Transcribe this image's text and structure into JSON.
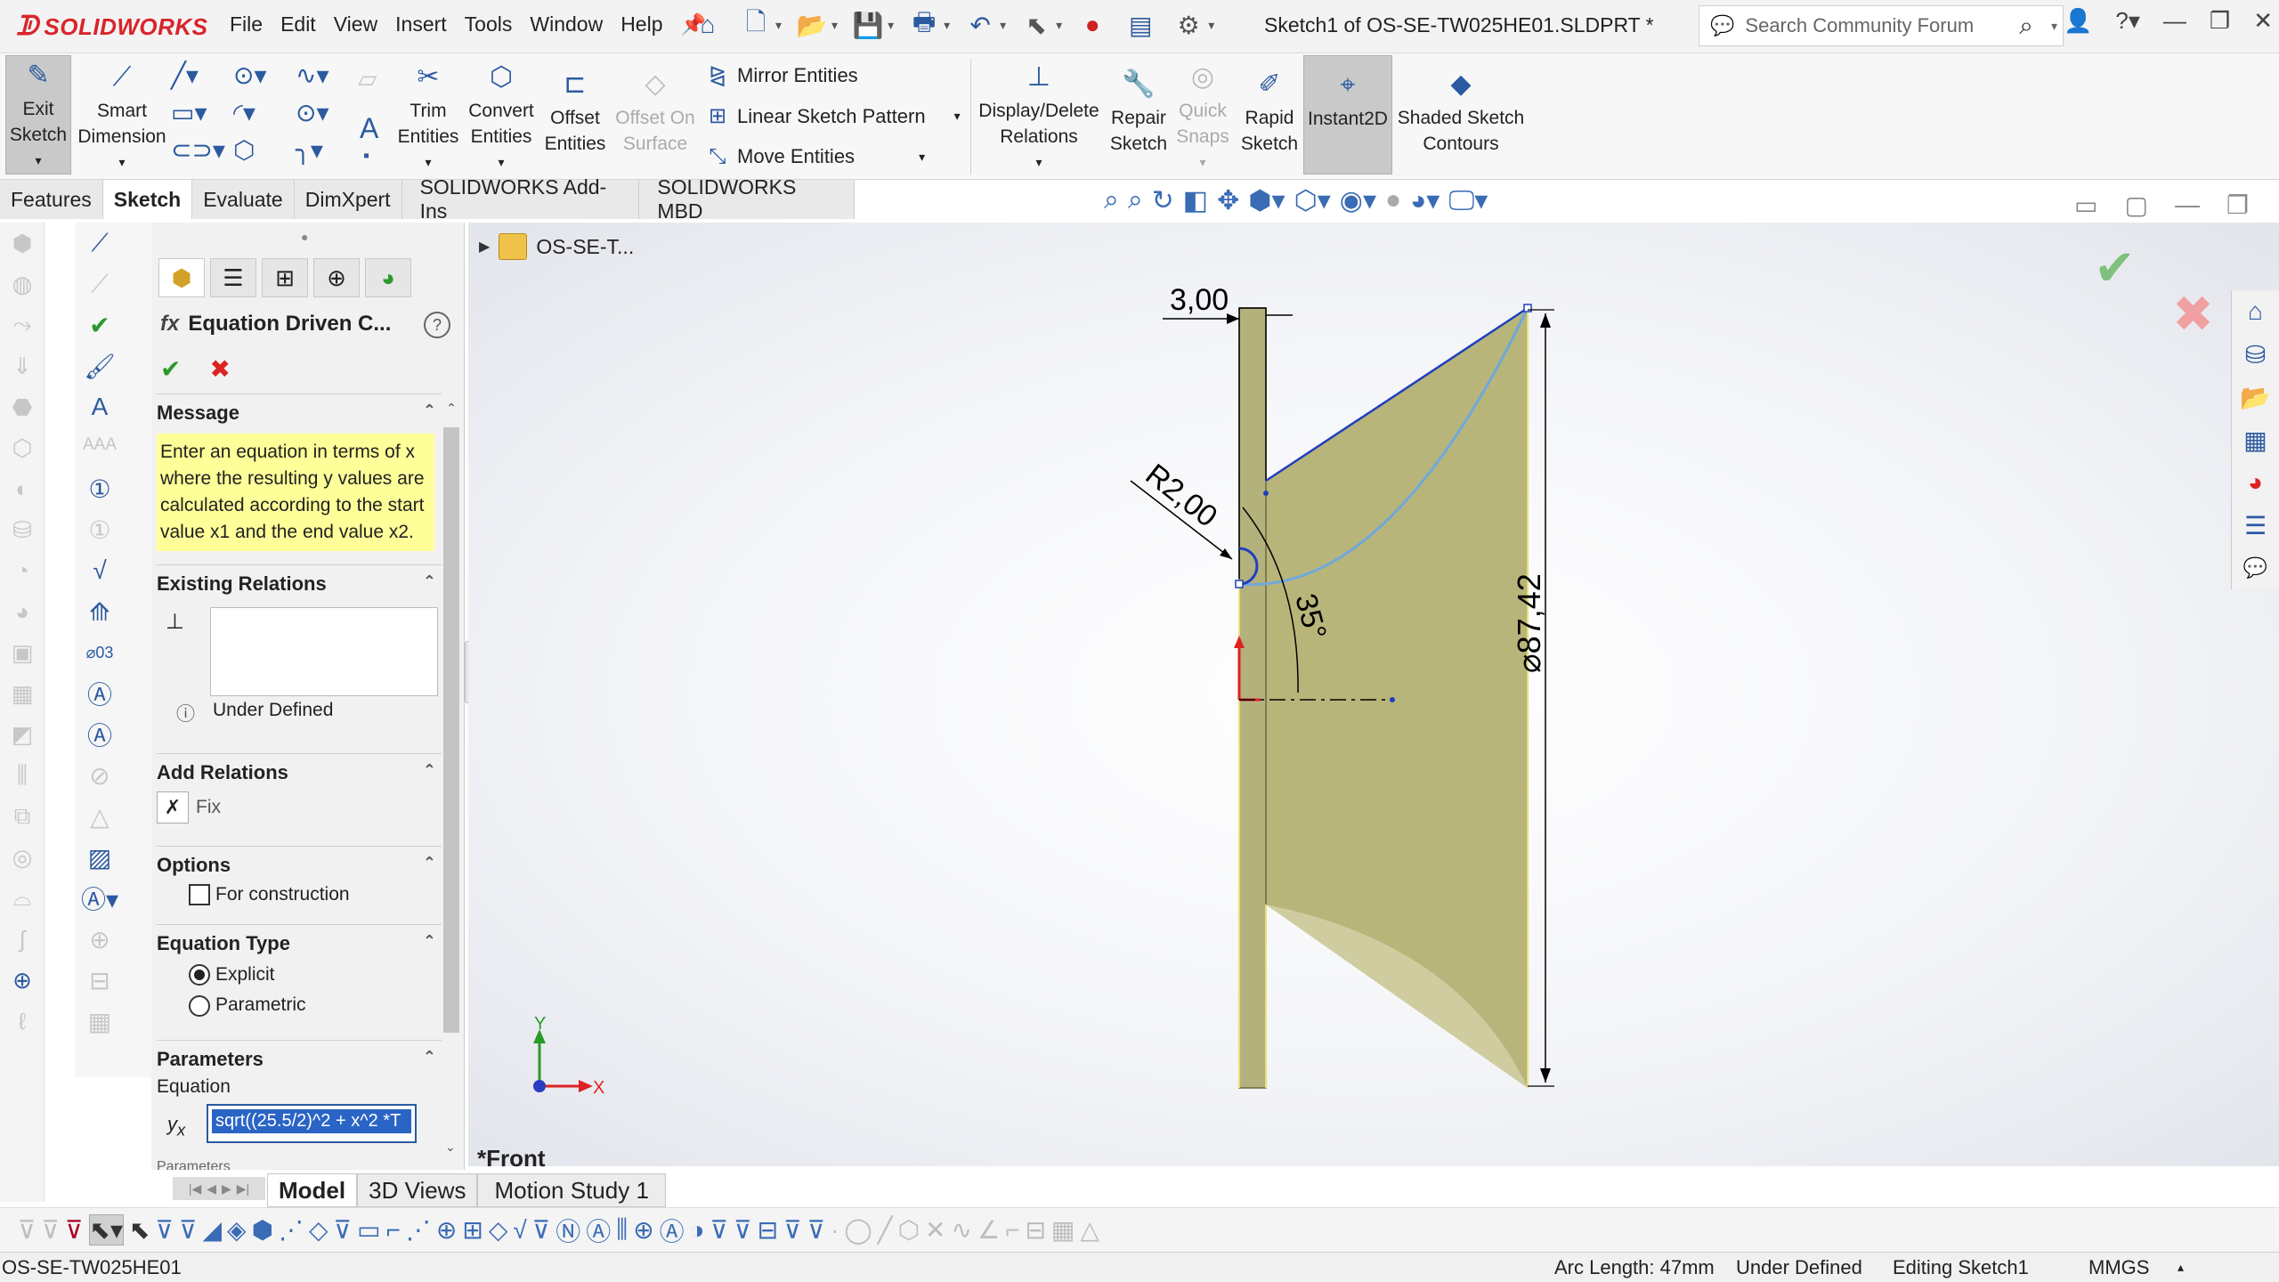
{
  "app": {
    "brand": "SOLIDWORKS",
    "document_title": "Sketch1 of OS-SE-TW025HE01.SLDPRT *",
    "menu": [
      "File",
      "Edit",
      "View",
      "Insert",
      "Tools",
      "Window",
      "Help"
    ],
    "search_placeholder": "Search Community Forum"
  },
  "ribbon": {
    "exit_sketch": "Exit\nSketch",
    "smart_dimension": "Smart\nDimension",
    "trim_entities": "Trim\nEntities",
    "convert_entities": "Convert\nEntities",
    "offset_entities": "Offset\nEntities",
    "offset_on_surface": "Offset On\nSurface",
    "mirror_entities": "Mirror Entities",
    "linear_sketch_pattern": "Linear Sketch Pattern",
    "move_entities": "Move Entities",
    "display_delete_relations": "Display/Delete\nRelations",
    "repair_sketch": "Repair\nSketch",
    "quick_snaps": "Quick\nSnaps",
    "rapid_sketch": "Rapid\nSketch",
    "instant2d": "Instant2D",
    "shaded_sketch_contours": "Shaded Sketch\nContours"
  },
  "tabs": [
    "Features",
    "Sketch",
    "Evaluate",
    "DimXpert",
    "SOLIDWORKS Add-Ins",
    "SOLIDWORKS MBD"
  ],
  "active_tab": "Sketch",
  "property_manager": {
    "title": "Equation Driven C...",
    "message_header": "Message",
    "message": "Enter an equation in terms of x where the resulting y values are calculated according to the start value x1 and the end value x2.",
    "existing_relations_header": "Existing Relations",
    "under_defined": "Under Defined",
    "add_relations_header": "Add Relations",
    "fix_label": "Fix",
    "options_header": "Options",
    "for_construction": "For construction",
    "equation_type_header": "Equation Type",
    "explicit": "Explicit",
    "parametric": "Parametric",
    "parameters_header": "Parameters",
    "equation_label": "Equation",
    "yx_label": "y",
    "yx_sub": "x",
    "equation_value": "sqrt((25.5/2)^2 + x^2 *T",
    "parameters_cut": "Parameters"
  },
  "canvas": {
    "tree_item": "OS-SE-T...",
    "view_name": "*Front",
    "dim_width": "3,00",
    "dim_radius": "R2,00",
    "dim_angle": "35°",
    "dim_diameter": "⌀87,42",
    "axis_x": "X",
    "axis_y": "Y"
  },
  "bottom_tabs": [
    "Model",
    "3D Views",
    "Motion Study 1"
  ],
  "active_bottom_tab": "Model",
  "status": {
    "file": "OS-SE-TW025HE01",
    "arc_length": "Arc Length: 47mm",
    "defined": "Under Defined",
    "editing": "Editing Sketch1",
    "units": "MMGS"
  },
  "colors": {
    "brand_red": "#d9242a",
    "message_yellow": "#ffff99",
    "part_fill": "#b8b57a",
    "sketch_blue": "#1f3fbf"
  }
}
